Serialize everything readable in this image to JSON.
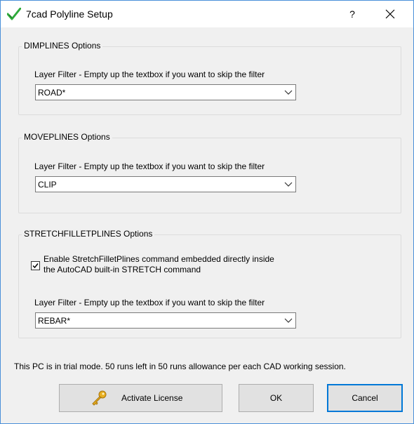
{
  "window": {
    "title": "7cad Polyline Setup",
    "help_label": "?"
  },
  "dimplines": {
    "group_title": "DIMPLINES Options",
    "filter_label": "Layer Filter - Empty up the textbox if you want to skip the filter",
    "filter_value": "ROAD*"
  },
  "moveplines": {
    "group_title": "MOVEPLINES Options",
    "filter_label": "Layer Filter - Empty up the textbox if you want to skip the filter",
    "filter_value": "CLIP"
  },
  "stretchfilletplines": {
    "group_title": "STRETCHFILLETPLINES Options",
    "checkbox_checked": true,
    "checkbox_label_line1": "Enable StretchFilletPlines command embedded directly inside",
    "checkbox_label_line2": "the AutoCAD built-in STRETCH command",
    "filter_label": "Layer Filter - Empty up the textbox if you want to skip the filter",
    "filter_value": "REBAR*"
  },
  "status": {
    "trial_text": "This PC is in trial mode. 50 runs left in 50 runs allowance per each CAD working session."
  },
  "buttons": {
    "activate_label": "Activate License",
    "ok_label": "OK",
    "cancel_label": "Cancel"
  },
  "icons": {
    "app": "green-checkmark-icon",
    "close": "close-icon",
    "combo_arrow": "chevron-down-icon",
    "activate": "key-icon"
  },
  "colors": {
    "app_icon_green": "#2eaa3a",
    "default_button_border": "#0078d7",
    "key_gold": "#e8b022"
  }
}
